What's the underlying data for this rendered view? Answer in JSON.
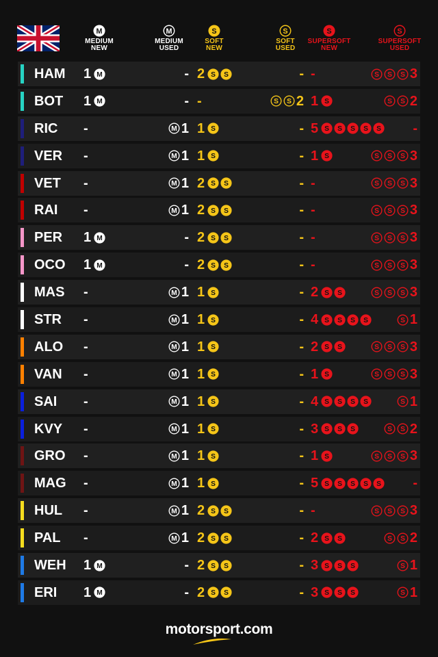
{
  "header": {
    "flag_icon": "uk-flag-icon",
    "columns": [
      {
        "lines": [
          "MEDIUM",
          "NEW"
        ],
        "letter": "M",
        "color": "#ffffff",
        "style": "filled"
      },
      {
        "lines": [
          "MEDIUM",
          "USED"
        ],
        "letter": "M",
        "color": "#ffffff",
        "style": "outline"
      },
      {
        "lines": [
          "SOFT",
          "NEW"
        ],
        "letter": "S",
        "color": "#f5c518",
        "style": "filled"
      },
      {
        "lines": [
          "SOFT",
          "USED"
        ],
        "letter": "S",
        "color": "#f5c518",
        "style": "outline"
      },
      {
        "lines": [
          "SUPERSOFT",
          "NEW"
        ],
        "letter": "S",
        "color": "#e8131b",
        "style": "filled"
      },
      {
        "lines": [
          "SUPERSOFT",
          "USED"
        ],
        "letter": "S",
        "color": "#e8131b",
        "style": "outline"
      }
    ]
  },
  "colors": {
    "medium": "#ffffff",
    "soft": "#f5c518",
    "supersoft": "#e8131b",
    "background": "#111111"
  },
  "rows": [
    {
      "code": "HAM",
      "team": "#27d3c3",
      "mn": "1",
      "mu": "-",
      "sn": "2",
      "su": "-",
      "ssn": "-",
      "ssu": "3"
    },
    {
      "code": "BOT",
      "team": "#27d3c3",
      "mn": "1",
      "mu": "-",
      "sn": "-",
      "su": "2",
      "ssn": "1",
      "ssu": "2"
    },
    {
      "code": "RIC",
      "team": "#1e1e7a",
      "mn": "-",
      "mu": "1",
      "sn": "1",
      "su": "-",
      "ssn": "5",
      "ssu": "-"
    },
    {
      "code": "VER",
      "team": "#1e1e7a",
      "mn": "-",
      "mu": "1",
      "sn": "1",
      "su": "-",
      "ssn": "1",
      "ssu": "3"
    },
    {
      "code": "VET",
      "team": "#c00000",
      "mn": "-",
      "mu": "1",
      "sn": "2",
      "su": "-",
      "ssn": "-",
      "ssu": "3"
    },
    {
      "code": "RAI",
      "team": "#c00000",
      "mn": "-",
      "mu": "1",
      "sn": "2",
      "su": "-",
      "ssn": "-",
      "ssu": "3"
    },
    {
      "code": "PER",
      "team": "#f596c8",
      "mn": "1",
      "mu": "-",
      "sn": "2",
      "su": "-",
      "ssn": "-",
      "ssu": "3"
    },
    {
      "code": "OCO",
      "team": "#f596c8",
      "mn": "1",
      "mu": "-",
      "sn": "2",
      "su": "-",
      "ssn": "-",
      "ssu": "3"
    },
    {
      "code": "MAS",
      "team": "#ffffff",
      "mn": "-",
      "mu": "1",
      "sn": "1",
      "su": "-",
      "ssn": "2",
      "ssu": "3"
    },
    {
      "code": "STR",
      "team": "#ffffff",
      "mn": "-",
      "mu": "1",
      "sn": "1",
      "su": "-",
      "ssn": "4",
      "ssu": "1"
    },
    {
      "code": "ALO",
      "team": "#ff8000",
      "mn": "-",
      "mu": "1",
      "sn": "1",
      "su": "-",
      "ssn": "2",
      "ssu": "3"
    },
    {
      "code": "VAN",
      "team": "#ff8000",
      "mn": "-",
      "mu": "1",
      "sn": "1",
      "su": "-",
      "ssn": "1",
      "ssu": "3"
    },
    {
      "code": "SAI",
      "team": "#0a1fdc",
      "mn": "-",
      "mu": "1",
      "sn": "1",
      "su": "-",
      "ssn": "4",
      "ssu": "1"
    },
    {
      "code": "KVY",
      "team": "#0a1fdc",
      "mn": "-",
      "mu": "1",
      "sn": "1",
      "su": "-",
      "ssn": "3",
      "ssu": "2"
    },
    {
      "code": "GRO",
      "team": "#6e1414",
      "mn": "-",
      "mu": "1",
      "sn": "1",
      "su": "-",
      "ssn": "1",
      "ssu": "3"
    },
    {
      "code": "MAG",
      "team": "#6e1414",
      "mn": "-",
      "mu": "1",
      "sn": "1",
      "su": "-",
      "ssn": "5",
      "ssu": "-"
    },
    {
      "code": "HUL",
      "team": "#f5dc1e",
      "mn": "-",
      "mu": "1",
      "sn": "2",
      "su": "-",
      "ssn": "-",
      "ssu": "3"
    },
    {
      "code": "PAL",
      "team": "#f5dc1e",
      "mn": "-",
      "mu": "1",
      "sn": "2",
      "su": "-",
      "ssn": "2",
      "ssu": "2"
    },
    {
      "code": "WEH",
      "team": "#1e7ae6",
      "mn": "1",
      "mu": "-",
      "sn": "2",
      "su": "-",
      "ssn": "3",
      "ssu": "1"
    },
    {
      "code": "ERI",
      "team": "#1e7ae6",
      "mn": "1",
      "mu": "-",
      "sn": "2",
      "su": "-",
      "ssn": "3",
      "ssu": "1"
    }
  ],
  "footer": {
    "logo_text": "motorsport.com"
  }
}
